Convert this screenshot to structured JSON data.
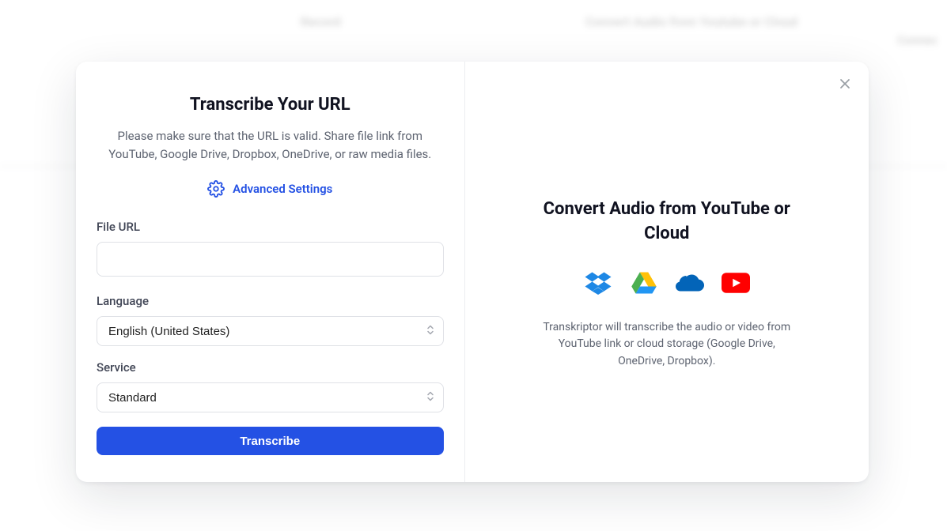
{
  "modal": {
    "left": {
      "title": "Transcribe Your URL",
      "subtitle": "Please make sure that the URL is valid. Share file link from YouTube, Google Drive, Dropbox, OneDrive, or raw media files.",
      "advanced_label": "Advanced Settings",
      "file_url_label": "File URL",
      "file_url_value": "",
      "file_url_placeholder": "",
      "language_label": "Language",
      "language_value": "English (United States)",
      "service_label": "Service",
      "service_value": "Standard",
      "transcribe_label": "Transcribe"
    },
    "right": {
      "title": "Convert Audio from YouTube or Cloud",
      "description": "Transkriptor will transcribe the audio or video from YouTube link or cloud storage (Google Drive, OneDrive, Dropbox)."
    }
  },
  "background": {
    "col2_title": "Record",
    "col3_title": "Convert Audio from Youtube or Cloud",
    "col4_text": "Connec"
  }
}
